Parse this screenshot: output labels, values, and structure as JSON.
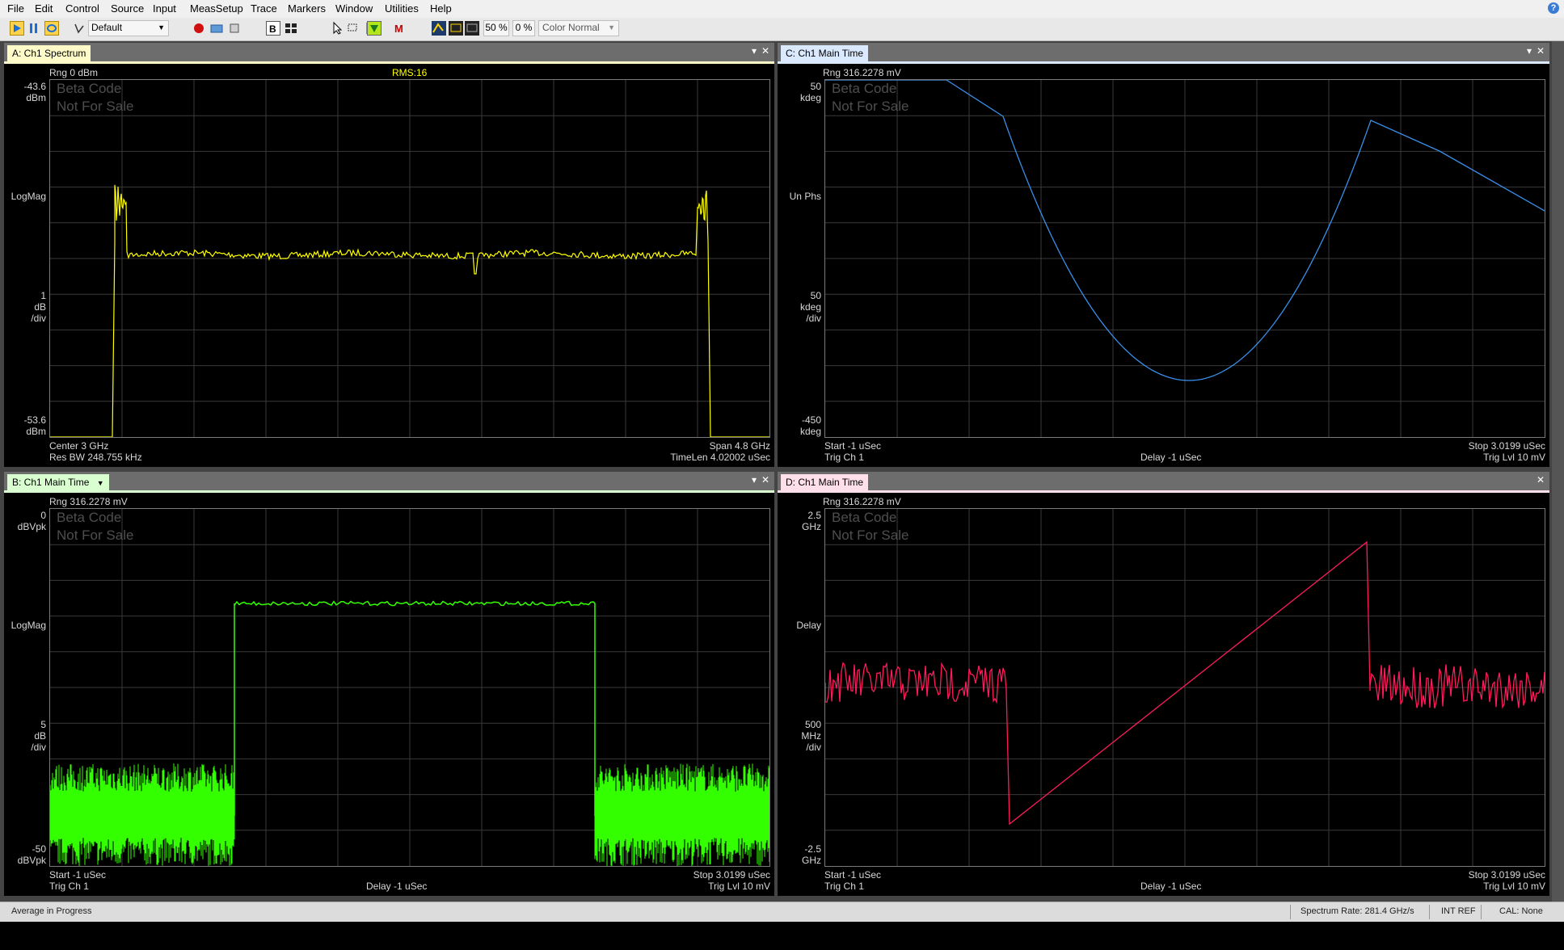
{
  "menu": [
    "File",
    "Edit",
    "Control",
    "Source",
    "Input",
    "MeasSetup",
    "Trace",
    "Markers",
    "Window",
    "Utilities",
    "Help"
  ],
  "toolbar": {
    "layout_select": "Default",
    "zoom1": "50 %",
    "zoom2": "0 %",
    "color_mode": "Color Normal"
  },
  "watermark": [
    "Beta Code",
    "Not For Sale"
  ],
  "panels": {
    "a": {
      "title": "A: Ch1 Spectrum",
      "color": "#ffff00",
      "range": "Rng 0 dBm",
      "rms": "RMS:16",
      "y_top": [
        "-43.6",
        "dBm"
      ],
      "y_mid": "LogMag",
      "y_scale": [
        "1",
        "dB",
        "/div"
      ],
      "y_bot": [
        "-53.6",
        "dBm"
      ],
      "bl1": "Center 3 GHz",
      "bl2": "Res BW 248.755 kHz",
      "br1": "Span 4.8 GHz",
      "br2": "TimeLen 4.02002 uSec"
    },
    "b": {
      "title": "B: Ch1 Main Time",
      "color": "#33ff00",
      "range": "Rng 316.2278 mV",
      "y_top": [
        "0",
        "dBVpk"
      ],
      "y_mid": "LogMag",
      "y_scale": [
        "5",
        "dB",
        "/div"
      ],
      "y_bot": [
        "-50",
        "dBVpk"
      ],
      "bl1": "Start -1 uSec",
      "bl2": "Trig Ch 1",
      "bc2": "Delay -1 uSec",
      "br1": "Stop 3.0199 uSec",
      "br2": "Trig Lvl 10 mV"
    },
    "c": {
      "title": "C: Ch1 Main Time",
      "color": "#3a8ee8",
      "range": "Rng 316.2278 mV",
      "y_top": [
        "50",
        "kdeg"
      ],
      "y_mid": "Un Phs",
      "y_scale": [
        "50",
        "kdeg",
        "/div"
      ],
      "y_bot": [
        "-450",
        "kdeg"
      ],
      "bl1": "Start -1 uSec",
      "bl2": "Trig Ch 1",
      "bc2": "Delay -1 uSec",
      "br1": "Stop 3.0199 uSec",
      "br2": "Trig Lvl 10 mV"
    },
    "d": {
      "title": "D: Ch1 Main Time",
      "color": "#ff1a5a",
      "range": "Rng 316.2278 mV",
      "y_top": [
        "2.5",
        "GHz"
      ],
      "y_mid": "Delay",
      "y_scale": [
        "500",
        "MHz",
        "/div"
      ],
      "y_bot": [
        "-2.5",
        "GHz"
      ],
      "bl1": "Start -1 uSec",
      "bl2": "Trig Ch 1",
      "bc2": "Delay -1 uSec",
      "br1": "Stop 3.0199 uSec",
      "br2": "Trig Lvl 10 mV"
    }
  },
  "status": {
    "left": "Average in Progress",
    "rate": "Spectrum Rate: 281.4 GHz/s",
    "ref": "INT REF",
    "cal": "CAL: None"
  }
}
